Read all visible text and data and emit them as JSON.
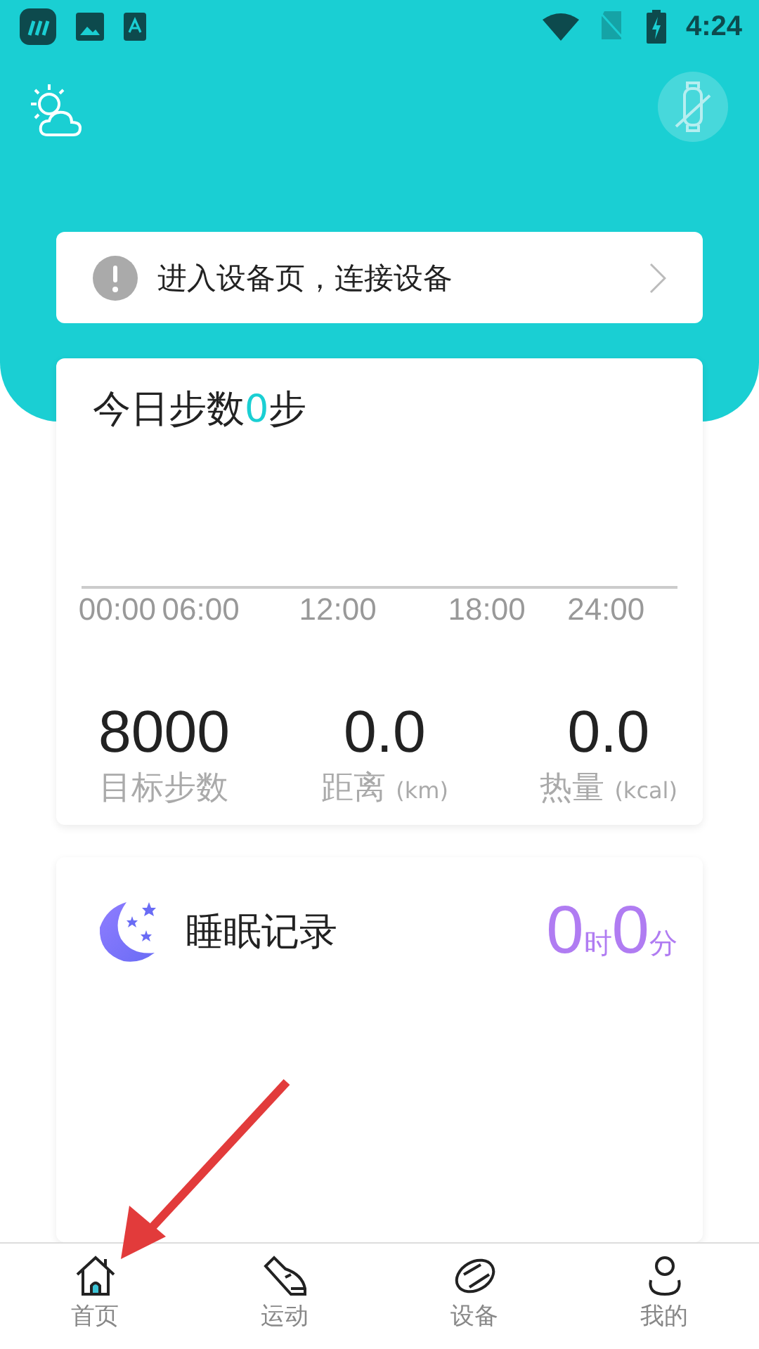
{
  "status_bar": {
    "time": "4:24"
  },
  "notice": {
    "text": "进入设备页，连接设备"
  },
  "steps_card": {
    "title": "今日步数",
    "count": "0",
    "unit": "步",
    "axis_labels": [
      "00:00",
      "06:00",
      "12:00",
      "18:00",
      "24:00"
    ],
    "stats": [
      {
        "value": "8000",
        "label": "目标步数"
      },
      {
        "value": "0.0",
        "label": "距离",
        "unit": "(km)"
      },
      {
        "value": "0.0",
        "label": "热量",
        "unit": "(kcal)"
      }
    ]
  },
  "sleep_card": {
    "title": "睡眠记录",
    "hours": "0",
    "hours_unit": "时",
    "minutes": "0",
    "minutes_unit": "分"
  },
  "tabs": [
    {
      "label": "首页",
      "selected": true
    },
    {
      "label": "运动",
      "selected": false
    },
    {
      "label": "设备",
      "selected": false
    },
    {
      "label": "我的",
      "selected": false
    }
  ]
}
